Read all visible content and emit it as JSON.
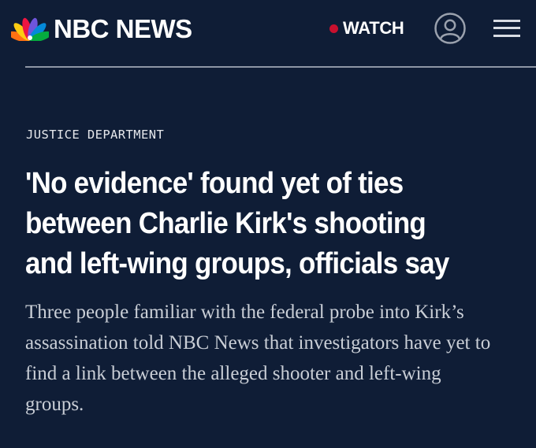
{
  "header": {
    "brand_text": "NBC NEWS",
    "watch_label": "WATCH",
    "icons": {
      "logo": "nbc-peacock-icon",
      "account": "user-account-icon",
      "menu": "hamburger-menu-icon",
      "live_dot": "live-dot-icon"
    }
  },
  "article": {
    "eyebrow": "JUSTICE DEPARTMENT",
    "headline_lines": [
      "'No evidence' found yet of ties",
      "between Charlie Kirk's shooting",
      "and left-wing groups, officials say"
    ],
    "dek_lines": [
      "Three people familiar with the federal probe into Kirk’s",
      "assassination told NBC News that investigators have yet to",
      "find a link between the alleged shooter and left-wing",
      "groups."
    ]
  },
  "colors": {
    "background": "#0f1d36",
    "text": "#ffffff",
    "dek_text": "#c9ced6",
    "live_dot": "#c8102e",
    "divider": "#8e96a5",
    "peacock": [
      "#fccc12",
      "#ef1541",
      "#6e55dc",
      "#0489d9",
      "#05ac3f",
      "#ff7112"
    ]
  }
}
